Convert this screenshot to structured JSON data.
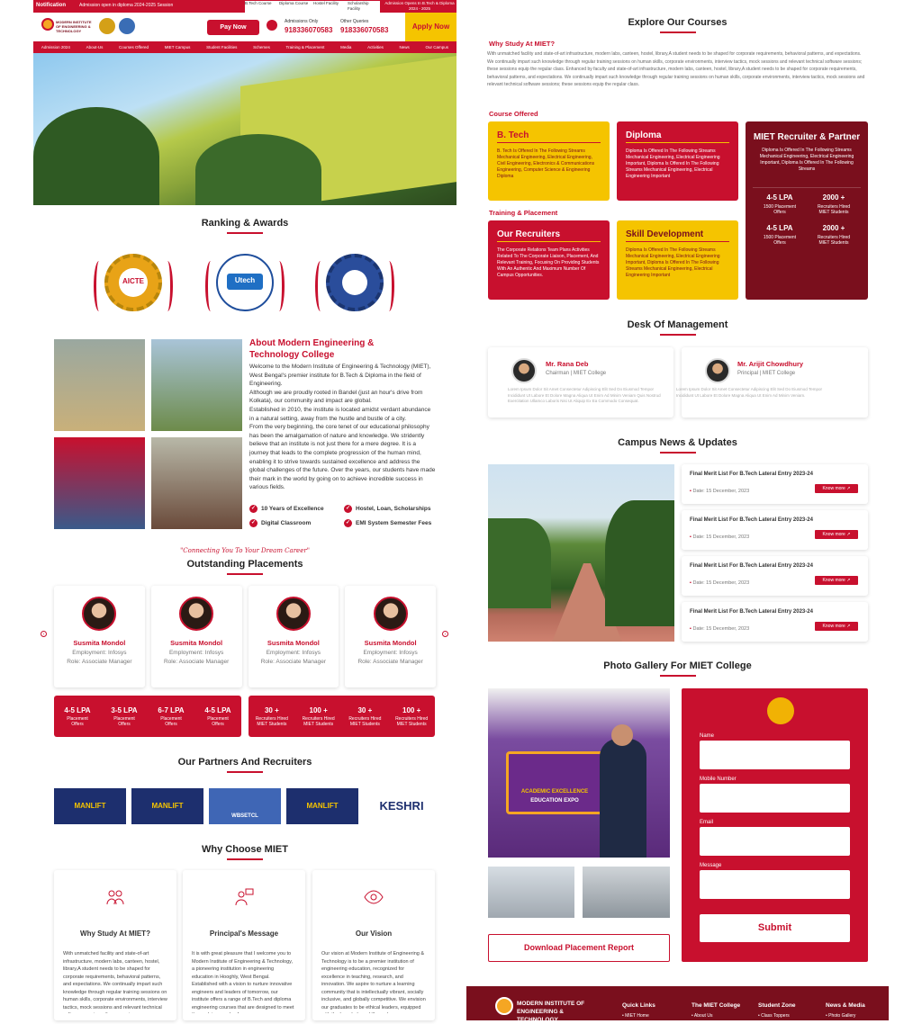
{
  "topbar": {
    "notification_label": "Notification",
    "ticker": "Admission open in diploma 2024-2025 Session",
    "links": [
      "B.Tech Course",
      "Diploma Course",
      "Hostel Facility",
      "Scholarship Facility"
    ],
    "admission_banner": "Admission Opens In B.Tech & Diploma 2024 - 2025"
  },
  "header": {
    "college_name": "MODERN INSTITUTE OF ENGINEERING & TECHNOLOGY",
    "pay_now": "Pay Now",
    "admissions_label": "Admissions Only",
    "admissions_phone": "918336070583",
    "other_label": "Other Queries",
    "other_phone": "918336070583",
    "apply_now": "Apply Now"
  },
  "nav": [
    "Admission 2024",
    "About-Us",
    "Courses Offered",
    "MIET Campus",
    "Student Facilities",
    "Schemes",
    "Training & Placement",
    "Media",
    "Activities",
    "News",
    "Our Campus"
  ],
  "ranking": {
    "title": "Ranking & Awards",
    "badges": [
      "AICTE",
      "Utech",
      ""
    ]
  },
  "about": {
    "title": "About Modern Engineering & Technology College",
    "paragraphs": [
      "Welcome to the Modern Institute of Engineering & Technology (MIET), West Bengal's premier institute for B.Tech & Diploma in the field of Engineering.",
      "Although we are proudly rooted in Bandel (just an hour's drive from Kolkata), our community and impact are global.",
      "Established in 2010, the institute is located amidst verdant abundance in a natural setting, away from the hustle and bustle of a city.",
      "From the very beginning, the core tenet of our educational philosophy has been the amalgamation of nature and knowledge. We stridently believe that an institute is not just there for a mere degree. It is a journey that leads to the complete progression of the human mind, enabling it to strive towards sustained excellence and address the global challenges of the future. Over the years, our students have made their mark in the world by going on to achieve incredible success in various fields."
    ],
    "features": [
      "10 Years of Excellence",
      "Hostel, Loan, Scholarships",
      "Digital Classroom",
      "EMI System Semester Fees"
    ]
  },
  "placements": {
    "tagline": "\"Connecting You To Your Dream Career\"",
    "title": "Outstanding Placements",
    "students": [
      {
        "name": "Susmita Mondol",
        "employment": "Employment: Infosys",
        "role": "Role: Associate Manager"
      },
      {
        "name": "Susmita Mondol",
        "employment": "Employment: Infosys",
        "role": "Role: Associate Manager"
      },
      {
        "name": "Susmita Mondol",
        "employment": "Employment: Infosys",
        "role": "Role: Associate Manager"
      },
      {
        "name": "Susmita Mondol",
        "employment": "Employment: Infosys",
        "role": "Role: Associate Manager"
      }
    ],
    "stats_left": [
      {
        "value": "4-5 LPA",
        "label": "Placement Offers"
      },
      {
        "value": "3-5 LPA",
        "label": "Placement Offers"
      },
      {
        "value": "6-7 LPA",
        "label": "Placement Offers"
      },
      {
        "value": "4-5 LPA",
        "label": "Placement Offers"
      }
    ],
    "stats_right": [
      {
        "value": "30 +",
        "label": "Recruiters Hired MIET Students"
      },
      {
        "value": "100 +",
        "label": "Recruiters Hired MIET Students"
      },
      {
        "value": "30 +",
        "label": "Recruiters Hired MIET Students"
      },
      {
        "value": "100 +",
        "label": "Recruiters Hired MIET Students"
      }
    ]
  },
  "partners": {
    "title": "Our Partners And Recruiters",
    "logos": [
      "MANLIFT",
      "MANLIFT",
      "WBSETCL",
      "MANLIFT",
      "KESHRI"
    ]
  },
  "why": {
    "title": "Why Choose MIET",
    "cards": [
      {
        "title": "Why Study At MIET?",
        "text": "With unmatched facility and state-of-art infrastructure, modern labs, canteen, hostel, library,A student needs to be shaped for corporate requirements, behavioral patterns, and expectations. We continually impart such knowledge through regular training sessions on human skills, corporate environments, interview tactics, mock sessions and relevant technical software sessions; these sessions"
      },
      {
        "title": "Principal's Message",
        "text": "It is with great pleasure that I welcome you to Modern Institute of Engineering & Technology, a pioneering institution in engineering education in Hooghly, West Bengal. Established with a vision to nurture innovative engineers and leaders of tomorrow, our institute offers a range of B.Tech and diploma engineering courses that are designed to meet the evolving needs of"
      },
      {
        "title": "Our Vision",
        "text": "Our vision at Modern Institute of Engineering & Technology is to be a premier institution of engineering education, recognized for excellence in teaching, research, and innovation. We aspire to nurture a learning community that is intellectually vibrant, socially inclusive, and globally competitive. We envision our graduates to be ethical leaders, equipped with the knowledge, skills, and"
      }
    ]
  },
  "courses": {
    "title": "Explore Our Courses",
    "why_heading": "Why Study At MIET?",
    "why_text": "With unmatched facility and state-of-art infrastructure, modern labs, canteen, hostel, library,A student needs to be shaped for corporate requirements, behavioral patterns, and expectations. We continually impart such knowledge through regular training sessions on human skills, corporate environments, interview tactics, mock sessions and relevant technical software sessions; these sessions equip the regular class. Enhanced by faculty and state-of-art infrastructure, modern labs, canteen, hostel, library,A student needs to be shaped for corporate requirements, behavioral patterns, and expectations. We continually impart such knowledge through regular training sessions on human skills, corporate environments, interview tactics, mock sessions and relevant technical software sessions; these sessions equip the regular class.",
    "offered_label": "Course Offered",
    "training_label": "Training & Placement",
    "btech": {
      "title": "B. Tech",
      "text": "B. Tech Is Offered In The Following Streams Mechanical Engineering, Electrical Engineering, Civil Engineering, Electronics & Communications Engineering, Computer Science & Engineering Diploma"
    },
    "diploma": {
      "title": "Diploma",
      "text": "Diploma Is Offered In The Following Streams Mechanical Engineering, Electrical Engineering Important, Diploma Is Offered In The Following Streams Mechanical Engineering, Electrical Engineering Important"
    },
    "recruiters": {
      "title": "Our Recruiters",
      "text": "The Corporate Relations Team Plans Activities Related To The Corporate Liaison, Placement, And Relevant Training, Focusing On Providing Students With An Authentic And Maximum Number Of Campus Opportunities."
    },
    "skill": {
      "title": "Skill Development",
      "text": "Diploma Is Offered In The Following Streams Mechanical Engineering, Electrical Engineering Important, Diploma Is Offered In The Following Streams Mechanical Engineering, Electrical Engineering Important"
    },
    "partner": {
      "title": "MIET Recruiter & Partner",
      "text": "Diploma Is Offered In The Following Streams Mechanical Engineering, Electrical Engineering Important, Diploma Is Offered In The Following Streams",
      "stats": [
        {
          "value": "4-5 LPA",
          "label": "1500 Placement Offers"
        },
        {
          "value": "2000 +",
          "label": "Recruiters Hired MIET Students"
        },
        {
          "value": "4-5 LPA",
          "label": "1500 Placement Offers"
        },
        {
          "value": "2000 +",
          "label": "Recruiters Hired MIET Students"
        }
      ]
    }
  },
  "management": {
    "title": "Desk Of Management",
    "people": [
      {
        "name": "Mr. Rana Deb",
        "role": "Chairman | MIET College",
        "text": "Lorem Ipsum Dolor Sit Amet Consectetur Adipiscing Elit Sed Do Eiusmod Tempor Incididunt Ut Labore Et Dolore Magna Aliqua Ut Enim Ad Minim Veniam Quis Nostrud Exercitation Ullamco Laboris Nisi Ut Aliquip Ex Ea Commodo Consequat."
      },
      {
        "name": "Mr. Arijit Chowdhury",
        "role": "Principal | MIET College",
        "text": "Lorem Ipsum Dolor Sit Amet Consectetur Adipiscing Elit Sed Do Eiusmod Tempor Incididunt Ut Labore Et Dolore Magna Aliqua Ut Enim Ad Minim Veniam."
      }
    ]
  },
  "news": {
    "title": "Campus News & Updates",
    "items": [
      {
        "title": "Final Merit List For B.Tech Lateral Entry 2023-24",
        "date": "Date: 15 December, 2023",
        "button": "Know more"
      },
      {
        "title": "Final Merit List For B.Tech Lateral Entry 2023-24",
        "date": "Date: 15 December, 2023",
        "button": "Know more"
      },
      {
        "title": "Final Merit List For B.Tech Lateral Entry 2023-24",
        "date": "Date: 15 December, 2023",
        "button": "Know more"
      },
      {
        "title": "Final Merit List For B.Tech Lateral Entry 2023-24",
        "date": "Date: 15 December, 2023",
        "button": "Know more"
      }
    ]
  },
  "gallery": {
    "title": "Photo Gallery For MIET College",
    "banner_text": "ACADEMIC EXCELLENCE",
    "banner_sub": "EDUCATION EXPO",
    "download": "Download Placement Report"
  },
  "form": {
    "name": "Name",
    "mobile": "Mobile Number",
    "email": "Email",
    "message": "Message",
    "submit": "Submit"
  },
  "footer": {
    "college_name": "MODERN INSTITUTE OF ENGINEERING & TECHNOLOGY",
    "cols": [
      {
        "title": "Quick Links",
        "item": "MIET Home"
      },
      {
        "title": "The MIET College",
        "item": "About Us"
      },
      {
        "title": "Student Zone",
        "item": "Class Toppers"
      },
      {
        "title": "News & Media",
        "item": "Photo Gallery"
      }
    ]
  },
  "colors": {
    "brand_red": "#c8102e",
    "yellow": "#f5c400",
    "dark_red": "#7a0f1d"
  }
}
